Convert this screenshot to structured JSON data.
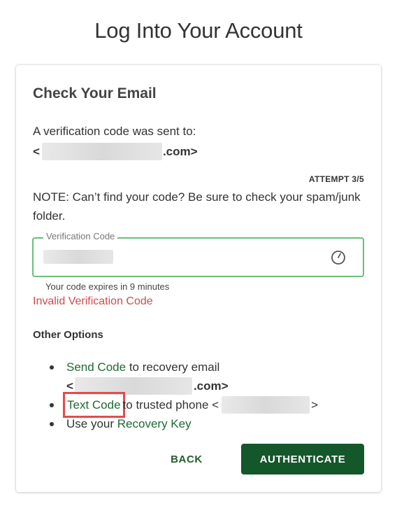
{
  "page": {
    "title": "Log Into Your Account"
  },
  "card": {
    "title": "Check Your Email",
    "sent_text": "A verification code was sent to:",
    "email_prefix": "<",
    "email_suffix": ".com>",
    "attempt": "ATTEMPT 3/5",
    "note": "NOTE: Can’t find your code? Be sure to check your spam/junk folder."
  },
  "verification": {
    "label": "Verification Code",
    "icon": "timer-icon",
    "expires": "Your code expires in 9 minutes",
    "error": "Invalid Verification Code",
    "colors": {
      "border": "#6abf7a",
      "error": "#d14a4a"
    }
  },
  "options": {
    "title": "Other Options",
    "send_code": {
      "link": "Send Code",
      "text": "to recovery email",
      "email_prefix": "<",
      "email_suffix": ".com>"
    },
    "text_code": {
      "link": "Text Code",
      "text": "to trusted phone <",
      "suffix": ">"
    },
    "recovery": {
      "text": "Use your",
      "link": "Recovery Key"
    }
  },
  "actions": {
    "back": "BACK",
    "authenticate": "AUTHENTICATE"
  },
  "colors": {
    "primary": "#14572b",
    "link": "#1f6a34",
    "highlight": "#e34c4c"
  }
}
